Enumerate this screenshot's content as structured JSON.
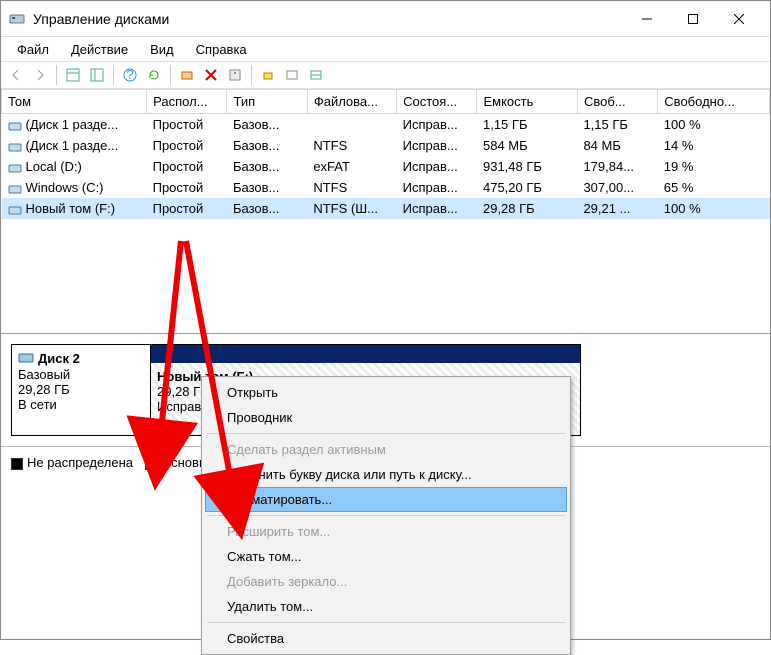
{
  "window": {
    "title": "Управление дисками"
  },
  "menu": {
    "file": "Файл",
    "action": "Действие",
    "view": "Вид",
    "help": "Справка"
  },
  "columns": [
    "Том",
    "Распол...",
    "Тип",
    "Файлова...",
    "Состоя...",
    "Емкость",
    "Своб...",
    "Свободно..."
  ],
  "volumes": [
    {
      "name": "(Диск 1 разде...",
      "layout": "Простой",
      "type": "Базов...",
      "fs": "",
      "status": "Исправ...",
      "cap": "1,15 ГБ",
      "free": "1,15 ГБ",
      "pct": "100 %",
      "selected": false
    },
    {
      "name": "(Диск 1 разде...",
      "layout": "Простой",
      "type": "Базов...",
      "fs": "NTFS",
      "status": "Исправ...",
      "cap": "584 МБ",
      "free": "84 МБ",
      "pct": "14 %",
      "selected": false
    },
    {
      "name": "Local (D:)",
      "layout": "Простой",
      "type": "Базов...",
      "fs": "exFAT",
      "status": "Исправ...",
      "cap": "931,48 ГБ",
      "free": "179,84...",
      "pct": "19 %",
      "selected": false
    },
    {
      "name": "Windows (C:)",
      "layout": "Простой",
      "type": "Базов...",
      "fs": "NTFS",
      "status": "Исправ...",
      "cap": "475,20 ГБ",
      "free": "307,00...",
      "pct": "65 %",
      "selected": false
    },
    {
      "name": "Новый том (F:)",
      "layout": "Простой",
      "type": "Базов...",
      "fs": "NTFS (Ш...",
      "status": "Исправ...",
      "cap": "29,28 ГБ",
      "free": "29,21 ...",
      "pct": "100 %",
      "selected": true
    }
  ],
  "disk": {
    "label": "Диск 2",
    "type": "Базовый",
    "size": "29,28 ГБ",
    "status": "В сети",
    "partition": {
      "name": "Новый том (F:)",
      "size": "29,28 ГБ NTFS",
      "state": "Исправен (Основной раздел)"
    }
  },
  "legend": {
    "unallocated": "Не распределена",
    "primary": "Основной раздел"
  },
  "ctx": {
    "open": "Открыть",
    "explorer": "Проводник",
    "mark_active": "Сделать раздел активным",
    "change_letter": "Изменить букву диска или путь к диску...",
    "format": "Форматировать...",
    "extend": "Расширить том...",
    "shrink": "Сжать том...",
    "add_mirror": "Добавить зеркало...",
    "delete": "Удалить том...",
    "properties": "Свойства"
  }
}
